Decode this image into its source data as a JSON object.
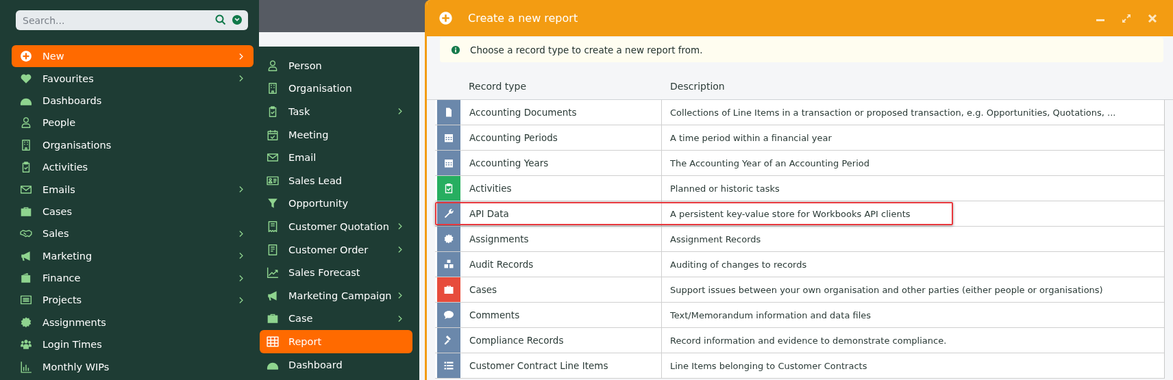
{
  "sidebar": {
    "search": {
      "placeholder": "Search..."
    },
    "items": [
      {
        "label": "New",
        "submenu": true,
        "selected": true
      },
      {
        "label": "Favourites",
        "submenu": true,
        "selected": false
      },
      {
        "label": "Dashboards",
        "submenu": false,
        "selected": false
      },
      {
        "label": "People",
        "submenu": false,
        "selected": false
      },
      {
        "label": "Organisations",
        "submenu": false,
        "selected": false
      },
      {
        "label": "Activities",
        "submenu": false,
        "selected": false
      },
      {
        "label": "Emails",
        "submenu": true,
        "selected": false
      },
      {
        "label": "Cases",
        "submenu": false,
        "selected": false
      },
      {
        "label": "Sales",
        "submenu": true,
        "selected": false
      },
      {
        "label": "Marketing",
        "submenu": true,
        "selected": false
      },
      {
        "label": "Finance",
        "submenu": true,
        "selected": false
      },
      {
        "label": "Projects",
        "submenu": true,
        "selected": false
      },
      {
        "label": "Assignments",
        "submenu": false,
        "selected": false
      },
      {
        "label": "Login Times",
        "submenu": false,
        "selected": false
      },
      {
        "label": "Monthly WIPs",
        "submenu": false,
        "selected": false
      }
    ]
  },
  "new_menu": {
    "items": [
      {
        "label": "Person",
        "submenu": false,
        "selected": false
      },
      {
        "label": "Organisation",
        "submenu": false,
        "selected": false
      },
      {
        "label": "Task",
        "submenu": true,
        "selected": false
      },
      {
        "label": "Meeting",
        "submenu": false,
        "selected": false
      },
      {
        "label": "Email",
        "submenu": false,
        "selected": false
      },
      {
        "label": "Sales Lead",
        "submenu": false,
        "selected": false
      },
      {
        "label": "Opportunity",
        "submenu": false,
        "selected": false
      },
      {
        "label": "Customer Quotation",
        "submenu": true,
        "selected": false
      },
      {
        "label": "Customer Order",
        "submenu": true,
        "selected": false
      },
      {
        "label": "Sales Forecast",
        "submenu": false,
        "selected": false
      },
      {
        "label": "Marketing Campaign",
        "submenu": true,
        "selected": false
      },
      {
        "label": "Case",
        "submenu": true,
        "selected": false
      },
      {
        "label": "Report",
        "submenu": false,
        "selected": true
      },
      {
        "label": "Dashboard",
        "submenu": false,
        "selected": false
      }
    ]
  },
  "dialog": {
    "title": "Create a new report",
    "info": "Choose a record type to create a new report from.",
    "table": {
      "columns": [
        "Record type",
        "Description"
      ],
      "rows": [
        {
          "record_type": "Accounting Documents",
          "description": "Collections of Line Items in a transaction or proposed transaction, e.g. Opportunities, Quotations, ...",
          "color": "#6b88ab",
          "highlighted": false
        },
        {
          "record_type": "Accounting Periods",
          "description": "A time period within a financial year",
          "color": "#6b88ab",
          "highlighted": false
        },
        {
          "record_type": "Accounting Years",
          "description": "The Accounting Year of an Accounting Period",
          "color": "#6b88ab",
          "highlighted": false
        },
        {
          "record_type": "Activities",
          "description": "Planned or historic tasks",
          "color": "#27ae60",
          "highlighted": false
        },
        {
          "record_type": "API Data",
          "description": "A persistent key-value store for Workbooks API clients",
          "color": "#6b88ab",
          "highlighted": true
        },
        {
          "record_type": "Assignments",
          "description": "Assignment Records",
          "color": "#6b88ab",
          "highlighted": false
        },
        {
          "record_type": "Audit Records",
          "description": "Auditing of changes to records",
          "color": "#6b88ab",
          "highlighted": false
        },
        {
          "record_type": "Cases",
          "description": "Support issues between your own organisation and other parties (either people or organisations)",
          "color": "#e74c3c",
          "highlighted": false
        },
        {
          "record_type": "Comments",
          "description": "Text/Memorandum information and data files",
          "color": "#6b88ab",
          "highlighted": false
        },
        {
          "record_type": "Compliance Records",
          "description": "Record information and evidence to demonstrate compliance.",
          "color": "#6b88ab",
          "highlighted": false
        },
        {
          "record_type": "Customer Contract Line Items",
          "description": "Line Items belonging to Customer Contracts",
          "color": "#6b88ab",
          "highlighted": false
        }
      ]
    }
  }
}
